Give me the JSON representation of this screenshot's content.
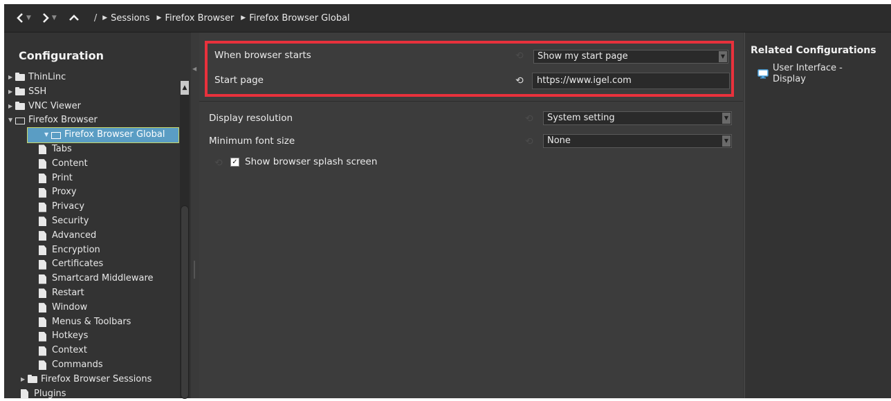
{
  "nav": {
    "back_icon": "chevron-left-icon",
    "forward_icon": "chevron-right-icon",
    "up_icon": "chevron-up-icon",
    "root_sep": "/",
    "breadcrumbs": [
      "Sessions",
      "Firefox Browser",
      "Firefox Browser Global"
    ]
  },
  "sidebar": {
    "title": "Configuration",
    "tree": [
      {
        "label": "ThinLinc",
        "level": 0,
        "type": "folder",
        "expanded": false
      },
      {
        "label": "SSH",
        "level": 0,
        "type": "folder",
        "expanded": false
      },
      {
        "label": "VNC Viewer",
        "level": 0,
        "type": "folder",
        "expanded": false
      },
      {
        "label": "Firefox Browser",
        "level": 0,
        "type": "folder",
        "expanded": true
      },
      {
        "label": "Firefox Browser Global",
        "level": 1,
        "type": "folder",
        "expanded": true,
        "selected": true
      },
      {
        "label": "Tabs",
        "level": 2,
        "type": "page"
      },
      {
        "label": "Content",
        "level": 2,
        "type": "page"
      },
      {
        "label": "Print",
        "level": 2,
        "type": "page"
      },
      {
        "label": "Proxy",
        "level": 2,
        "type": "page"
      },
      {
        "label": "Privacy",
        "level": 2,
        "type": "page"
      },
      {
        "label": "Security",
        "level": 2,
        "type": "page"
      },
      {
        "label": "Advanced",
        "level": 2,
        "type": "page"
      },
      {
        "label": "Encryption",
        "level": 2,
        "type": "page"
      },
      {
        "label": "Certificates",
        "level": 2,
        "type": "page"
      },
      {
        "label": "Smartcard Middleware",
        "level": 2,
        "type": "page"
      },
      {
        "label": "Restart",
        "level": 2,
        "type": "page"
      },
      {
        "label": "Window",
        "level": 2,
        "type": "page"
      },
      {
        "label": "Menus & Toolbars",
        "level": 2,
        "type": "page"
      },
      {
        "label": "Hotkeys",
        "level": 2,
        "type": "page"
      },
      {
        "label": "Context",
        "level": 2,
        "type": "page"
      },
      {
        "label": "Commands",
        "level": 2,
        "type": "page"
      },
      {
        "label": "Firefox Browser Sessions",
        "level": 1,
        "type": "folder",
        "expanded": false
      },
      {
        "label": "Plugins",
        "level": 1,
        "type": "page"
      }
    ]
  },
  "main": {
    "when_starts_label": "When browser starts",
    "when_starts_value": "Show my start page",
    "start_page_label": "Start page",
    "start_page_value": "https://www.igel.com",
    "display_resolution_label": "Display resolution",
    "display_resolution_value": "System setting",
    "min_font_label": "Minimum font size",
    "min_font_value": "None",
    "splash_label": "Show browser splash screen",
    "splash_checked": true,
    "highlight_color": "#e8313c"
  },
  "related": {
    "title": "Related Configurations",
    "link_label": "User Interface - Display",
    "link_icon": "monitor-icon"
  }
}
